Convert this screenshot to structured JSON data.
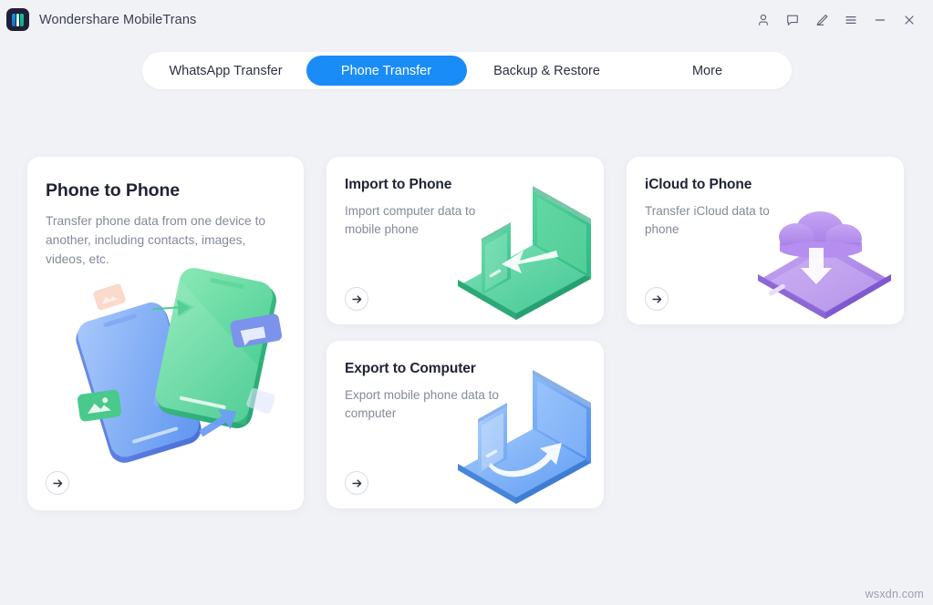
{
  "window": {
    "app_title": "Wondershare MobileTrans",
    "logo_icon": "mobiletrans-logo-icon",
    "controls": [
      {
        "name": "account-icon",
        "label": "Account"
      },
      {
        "name": "feedback-icon",
        "label": "Feedback"
      },
      {
        "name": "edit-pen-icon",
        "label": "Edit"
      },
      {
        "name": "menu-icon",
        "label": "Menu"
      },
      {
        "name": "minimize-icon",
        "label": "Minimize"
      },
      {
        "name": "close-icon",
        "label": "Close"
      }
    ]
  },
  "tabs": [
    {
      "label": "WhatsApp Transfer",
      "active": false
    },
    {
      "label": "Phone Transfer",
      "active": true
    },
    {
      "label": "Backup & Restore",
      "active": false
    },
    {
      "label": "More",
      "active": false
    }
  ],
  "cards": {
    "phone_to_phone": {
      "title": "Phone to Phone",
      "desc": "Transfer phone data from one device to another, including contacts, images, videos, etc.",
      "action": "arrow-right-icon",
      "illustration": "two-phones-transfer-illustration"
    },
    "import_to_phone": {
      "title": "Import to Phone",
      "desc": "Import computer data to mobile phone",
      "action": "arrow-right-icon",
      "illustration": "laptop-to-phone-green-illustration"
    },
    "icloud_to_phone": {
      "title": "iCloud to Phone",
      "desc": "Transfer iCloud data to phone",
      "action": "arrow-right-icon",
      "illustration": "cloud-to-phone-purple-illustration"
    },
    "export_to_computer": {
      "title": "Export to Computer",
      "desc": "Export mobile phone data to computer",
      "action": "arrow-right-icon",
      "illustration": "phone-to-laptop-blue-illustration"
    }
  },
  "watermark": "wsxdn.com",
  "colors": {
    "accent_blue": "#1a8cf7",
    "background": "#f1f2f6",
    "card": "#ffffff",
    "title_text": "#1f2333",
    "body_text": "#838a99",
    "green_illus": "#3ecf8e",
    "purple_illus": "#a881e6",
    "blue_illus": "#5b9cf5"
  }
}
